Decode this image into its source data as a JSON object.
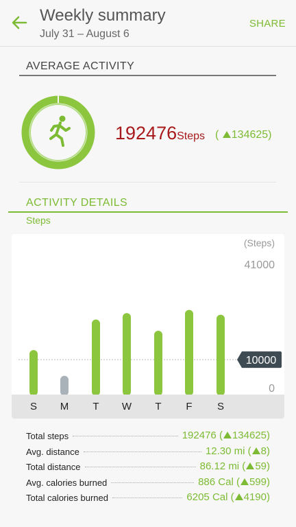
{
  "header": {
    "title": "Weekly summary",
    "date_range": "July 31 – August 6",
    "share_label": "SHARE"
  },
  "average": {
    "heading": "AVERAGE ACTIVITY",
    "steps_value": "192476",
    "steps_unit": "Steps",
    "change_open": "(",
    "change_value": "134625)",
    "ring_icon": "running-person-icon"
  },
  "details": {
    "heading": "ACTIVITY DETAILS",
    "metric_label": "Steps"
  },
  "chart_data": {
    "type": "bar",
    "unit_label": "(Steps)",
    "y_max_label": "41000",
    "y_min_label": "0",
    "goal_label": "10000",
    "categories": [
      "S",
      "M",
      "T",
      "W",
      "T",
      "F",
      "S"
    ],
    "values": [
      13000,
      5000,
      22500,
      24500,
      19000,
      25500,
      24000
    ],
    "goal": 10000,
    "ylim": [
      0,
      41000
    ],
    "colors": {
      "active": "#8cc63f",
      "below_goal": "#a9b2b8",
      "goal_flag": "#3f4b52"
    }
  },
  "stats": [
    {
      "label": "Total steps",
      "value": "192476 (",
      "delta": "134625)"
    },
    {
      "label": "Avg. distance",
      "value": "12.30 mi (",
      "delta": "8)"
    },
    {
      "label": "Total distance",
      "value": "86.12 mi (",
      "delta": "59)"
    },
    {
      "label": "Avg. calories burned",
      "value": "886 Cal (",
      "delta": "599)"
    },
    {
      "label": "Total calories burned",
      "value": "6205 Cal (",
      "delta": "4190)"
    }
  ],
  "colors": {
    "accent": "#7cbb33",
    "steps_red": "#a8191b"
  }
}
